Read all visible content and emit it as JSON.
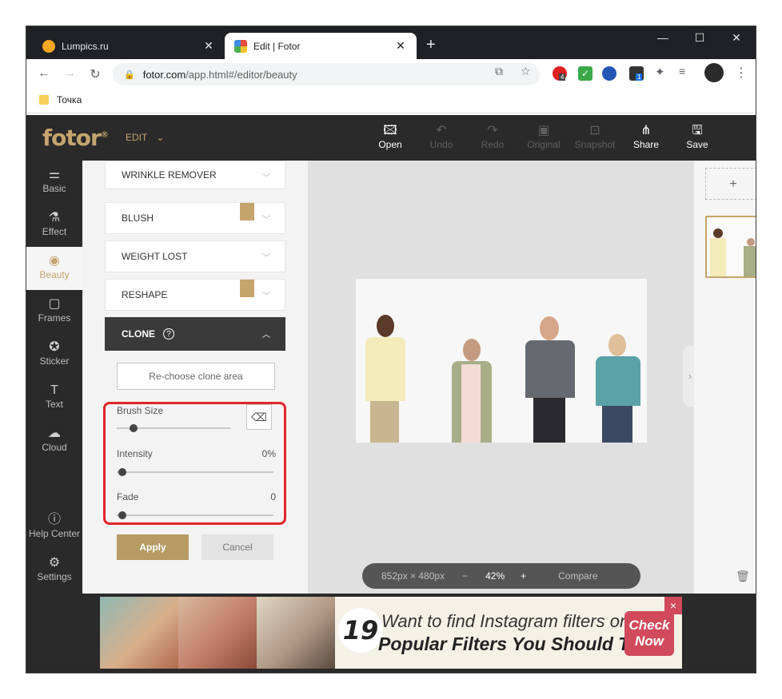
{
  "browser": {
    "tabs": [
      {
        "title": "Lumpics.ru",
        "active": false
      },
      {
        "title": "Edit | Fotor",
        "active": true
      }
    ],
    "new_tab": "+",
    "url_host": "fotor.com",
    "url_path": "/app.html#/editor/beauty",
    "bookmark": "Точка",
    "ext_badges": {
      "opera": "4",
      "cube": "1"
    }
  },
  "fotor": {
    "logo": "fotor",
    "logo_mark": "®",
    "edit_menu": "EDIT",
    "header_buttons": {
      "open": "Open",
      "undo": "Undo",
      "redo": "Redo",
      "original": "Original",
      "snapshot": "Snapshot",
      "share": "Share",
      "save": "Save"
    },
    "left_nav": {
      "basic": "Basic",
      "effect": "Effect",
      "beauty": "Beauty",
      "frames": "Frames",
      "sticker": "Sticker",
      "text": "Text",
      "cloud": "Cloud",
      "help": "Help Center",
      "settings": "Settings"
    },
    "panel": {
      "wrinkle": "WRINKLE REMOVER",
      "blush": "BLUSH",
      "weight": "WEIGHT LOST",
      "reshape": "RESHAPE",
      "clone": "CLONE",
      "clone_help": "?",
      "rechoose": "Re-choose clone area",
      "brush_label": "Brush Size",
      "brush_level": 0.15,
      "intensity_label": "Intensity",
      "intensity_value": "0%",
      "fade_label": "Fade",
      "fade_value": "0",
      "apply": "Apply",
      "cancel": "Cancel"
    },
    "zoom": {
      "dimensions": "852px × 480px",
      "minus": "−",
      "percent": "42%",
      "plus": "+",
      "compare": "Compare"
    },
    "right_panel": {
      "add": "+"
    }
  },
  "ad": {
    "number": "19",
    "line1": "Want to find Instagram filters online?",
    "line2": "Popular Filters You Should Try",
    "cta_line1": "Check",
    "cta_line2": "Now",
    "close": "×"
  },
  "colors": {
    "gold": "#c5a46d",
    "dark": "#2a2a2a",
    "highlight": "#e0242b",
    "apply": "#b69b63"
  }
}
